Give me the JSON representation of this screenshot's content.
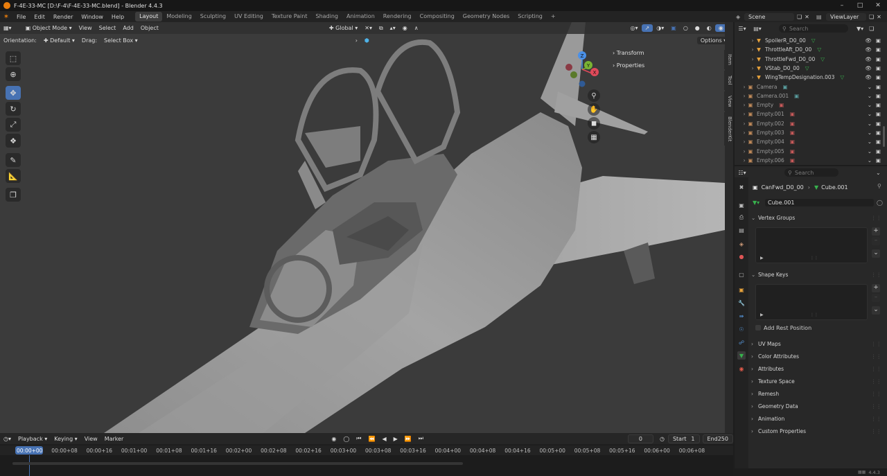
{
  "titlebar": {
    "title": "F-4E-33-MC [D:\\F-4\\F-4E-33-MC.blend] - Blender 4.4.3"
  },
  "menubar": {
    "menus": [
      "File",
      "Edit",
      "Render",
      "Window",
      "Help"
    ],
    "workspaces": [
      "Layout",
      "Modeling",
      "Sculpting",
      "UV Editing",
      "Texture Paint",
      "Shading",
      "Animation",
      "Rendering",
      "Compositing",
      "Geometry Nodes",
      "Scripting"
    ],
    "add_tab": "+",
    "scene": "Scene",
    "view_layer": "ViewLayer"
  },
  "viewport": {
    "mode": "Object Mode",
    "menus": [
      "View",
      "Select",
      "Add",
      "Object"
    ],
    "transform_orientation": "Global",
    "orientation_label": "Orientation:",
    "orientation_value": "Default",
    "drag_label": "Drag:",
    "drag_value": "Select Box",
    "options": "Options",
    "n_panels": [
      "Transform",
      "Properties"
    ],
    "n_tabs": [
      "Item",
      "Tool",
      "View",
      "BlenderKit"
    ],
    "gizmo": {
      "z": "Z",
      "y": "Y",
      "x": "X"
    }
  },
  "timeline": {
    "menus": [
      "Playback",
      "Keying",
      "View",
      "Marker"
    ],
    "current_frame": "0",
    "start_label": "Start",
    "start_value": "1",
    "end_label": "End",
    "end_value": "250",
    "ticks": [
      "00:00+00",
      "00:00+08",
      "00:00+16",
      "00:01+00",
      "00:01+08",
      "00:01+16",
      "00:02+00",
      "00:02+08",
      "00:02+16",
      "00:03+00",
      "00:03+08",
      "00:03+16",
      "00:04+00",
      "00:04+08",
      "00:04+16",
      "00:05+00",
      "00:05+08",
      "00:05+16",
      "00:06+00",
      "00:06+08"
    ]
  },
  "outliner": {
    "search_placeholder": "Search",
    "rows": [
      {
        "name": "SpoilerR_D0_00"
      },
      {
        "name": "ThrottleAft_D0_00"
      },
      {
        "name": "ThrottleFwd_D0_00"
      },
      {
        "name": "VStab_D0_00"
      },
      {
        "name": "WingTempDesignation.003"
      },
      {
        "name": "Camera"
      },
      {
        "name": "Camera.001"
      },
      {
        "name": "Empty"
      },
      {
        "name": "Empty.001"
      },
      {
        "name": "Empty.002"
      },
      {
        "name": "Empty.003"
      },
      {
        "name": "Empty.004"
      },
      {
        "name": "Empty.005"
      },
      {
        "name": "Empty.006"
      }
    ]
  },
  "properties": {
    "search_placeholder": "Search",
    "object_name": "CanFwd_D0_00",
    "mesh_name": "Cube.001",
    "datablock": "Cube.001",
    "sections": {
      "vertex_groups": "Vertex Groups",
      "shape_keys": "Shape Keys",
      "add_rest_position": "Add Rest Position",
      "collapsed": [
        "UV Maps",
        "Color Attributes",
        "Attributes",
        "Texture Space",
        "Remesh",
        "Geometry Data",
        "Animation",
        "Custom Properties"
      ]
    }
  },
  "statusbar": {
    "version": "4.4.3"
  },
  "colors": {
    "accent": "#4772b3",
    "viewport_bg": "#3b3b3b",
    "panel_bg": "#282828",
    "mesh_icon": "#37b24d",
    "object_icon": "#e8a33c"
  }
}
